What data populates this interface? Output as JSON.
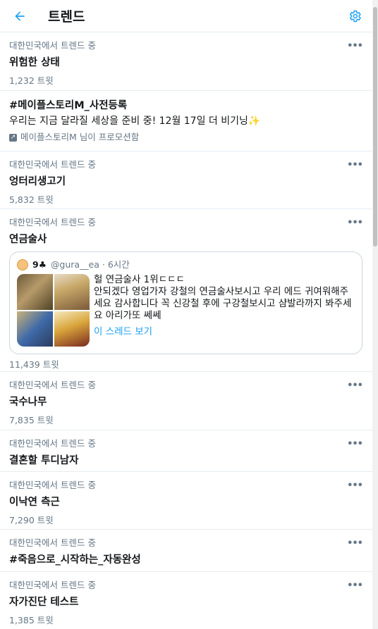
{
  "header": {
    "title": "트렌드",
    "back_icon": "back-arrow-icon",
    "settings_icon": "gear-icon"
  },
  "colors": {
    "accent": "#1da1f2",
    "secondary_text": "#657786",
    "border": "#e6ecf0"
  },
  "more_label": "•••",
  "trends": [
    {
      "context": "대한민국에서 트렌드 중",
      "name": "위험한 상태",
      "count": "1,232 트윗"
    },
    {
      "context": "대한민국에서 트렌드 중",
      "name": "엉터리생고기",
      "count": "5,832 트윗"
    },
    {
      "context": "대한민국에서 트렌드 중",
      "name": "연금술사",
      "count": "11,439 트윗"
    },
    {
      "context": "대한민국에서 트렌드 중",
      "name": "국수나무",
      "count": "7,835 트윗"
    },
    {
      "context": "대한민국에서 트렌드 중",
      "name": "결혼할 투디남자",
      "count": ""
    },
    {
      "context": "대한민국에서 트렌드 중",
      "name": "이낙연 측근",
      "count": "7,290 트윗"
    },
    {
      "context": "대한민국에서 트렌드 중",
      "name": "#죽음으로_시작하는_자동완성",
      "count": ""
    },
    {
      "context": "대한민국에서 트렌드 중",
      "name": "자가진단 테스트",
      "count": "1,385 트윗"
    }
  ],
  "promoted": {
    "name": "#메이플스토리M_사전등록",
    "description": "우리는 지금 달라질 세상을 준비 중! 12월 17일 더 비기닝✨",
    "by": "메이플스토리M 님이 프로모션함"
  },
  "tweet": {
    "user": "9♣",
    "handle_time": "@gura__ea · 6시간",
    "line1": "헐 연금술사 1위ㄷㄷㄷ",
    "line2": "안되겠다 영업가자 강철의 연금술사보시고 우리 에드 귀여워해주세요 감사합니다 꼭 신강철 후에 구강철보시고 샴발라까지 봐주세요 아리가또 쎄쎄",
    "thread_link": "이 스레드 보기"
  }
}
